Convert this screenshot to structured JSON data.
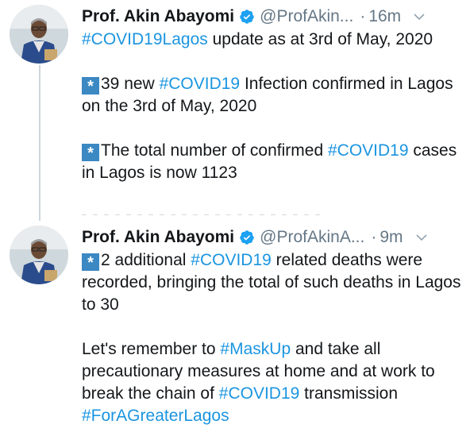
{
  "tweets": [
    {
      "name": "Prof. Akin Abayomi",
      "handle": "@ProfAkin...",
      "dot": "·",
      "time": "16m",
      "lines": {
        "p1_tag": "#COVID19Lagos",
        "p1_text": " update  as at 3rd of May, 2020",
        "p2_marker": "*",
        "p2_text_a": "39 new ",
        "p2_tag": "#COVID19",
        "p2_text_b": " Infection confirmed in Lagos on the 3rd of May, 2020",
        "p3_marker": "*",
        "p3_text_a": "The total number of confirmed ",
        "p3_tag": "#COVID19",
        "p3_text_b": " cases in Lagos is now 1123"
      }
    },
    {
      "name": "Prof. Akin Abayomi",
      "handle": "@ProfAkinA...",
      "dot": "·",
      "time": "9m",
      "lines": {
        "p1_marker": "*",
        "p1_text_a": "2 additional ",
        "p1_tag": "#COVID19",
        "p1_text_b": " related deaths were recorded, bringing the total of such deaths in Lagos to 30",
        "p2_text_a": "Let's remember to ",
        "p2_tag1": "#MaskUp",
        "p2_text_b": " and take all precautionary measures at home and at work to break the chain of ",
        "p2_tag2": "#COVID19",
        "p2_text_c": " transmission",
        "p2_tag3": "#ForAGreaterLagos"
      }
    }
  ],
  "colors": {
    "link": "#1b95e0",
    "verified": "#1da1f2",
    "secondary": "#657786",
    "marker": "#3b88c3"
  },
  "icons": {
    "verified": "verified-badge-icon",
    "menu": "chevron-down-icon",
    "marker": "asterisk-square-icon"
  }
}
